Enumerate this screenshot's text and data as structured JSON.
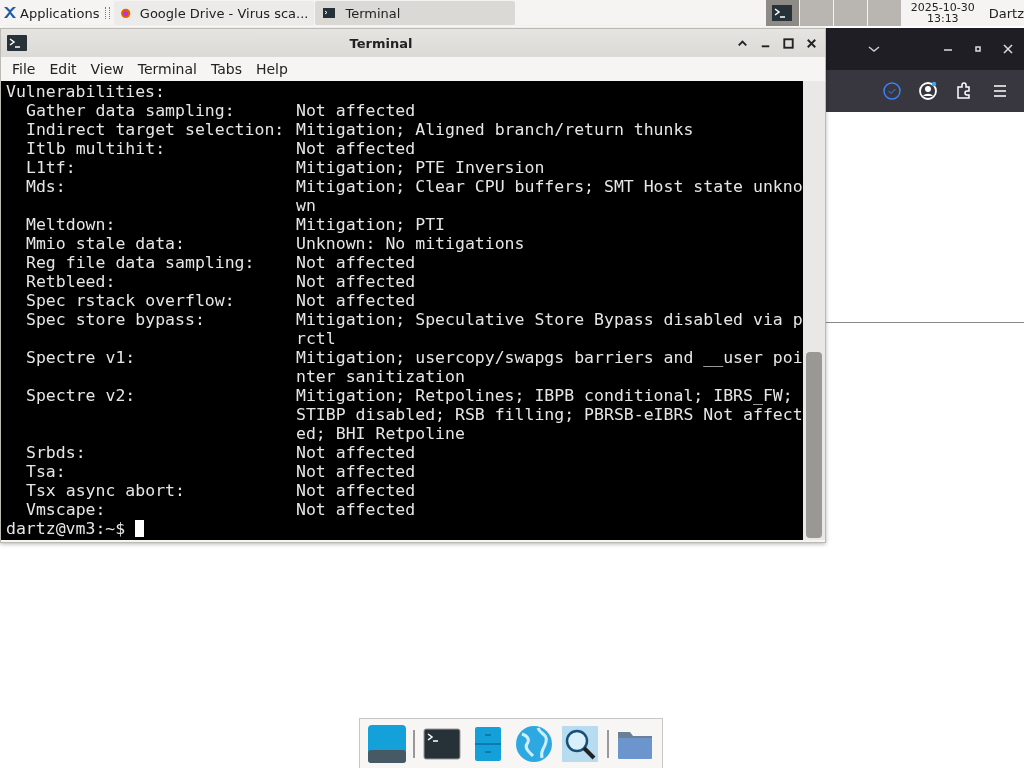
{
  "panel": {
    "apps_label": "Applications",
    "tasks": [
      {
        "title": "Google Drive - Virus sca...",
        "kind": "browser",
        "selected": false
      },
      {
        "title": "Terminal",
        "kind": "terminal",
        "selected": true
      }
    ],
    "workspaces": [
      {
        "selected": true
      },
      {
        "selected": false
      },
      {
        "selected": false
      },
      {
        "selected": false
      }
    ],
    "date": "2025-10-30",
    "time": "13:13",
    "user": "Dartz"
  },
  "terminal": {
    "title": "Terminal",
    "menu": [
      "File",
      "Edit",
      "View",
      "Terminal",
      "Tabs",
      "Help"
    ],
    "heading": "Vulnerabilities:",
    "rows": [
      {
        "label": "Gather data sampling:",
        "value_lines": [
          "Not affected"
        ]
      },
      {
        "label": "Indirect target selection:",
        "value_lines": [
          "Mitigation; Aligned branch/return thunks"
        ]
      },
      {
        "label": "Itlb multihit:",
        "value_lines": [
          "Not affected"
        ]
      },
      {
        "label": "L1tf:",
        "value_lines": [
          "Mitigation; PTE Inversion"
        ]
      },
      {
        "label": "Mds:",
        "value_lines": [
          "Mitigation; Clear CPU buffers; SMT Host state unkno",
          "wn"
        ]
      },
      {
        "label": "Meltdown:",
        "value_lines": [
          "Mitigation; PTI"
        ]
      },
      {
        "label": "Mmio stale data:",
        "value_lines": [
          "Unknown: No mitigations"
        ]
      },
      {
        "label": "Reg file data sampling:",
        "value_lines": [
          "Not affected"
        ]
      },
      {
        "label": "Retbleed:",
        "value_lines": [
          "Not affected"
        ]
      },
      {
        "label": "Spec rstack overflow:",
        "value_lines": [
          "Not affected"
        ]
      },
      {
        "label": "Spec store bypass:",
        "value_lines": [
          "Mitigation; Speculative Store Bypass disabled via p",
          "rctl"
        ]
      },
      {
        "label": "Spectre v1:",
        "value_lines": [
          "Mitigation; usercopy/swapgs barriers and __user poi",
          "nter sanitization"
        ]
      },
      {
        "label": "Spectre v2:",
        "value_lines": [
          "Mitigation; Retpolines; IBPB conditional; IBRS_FW;",
          "STIBP disabled; RSB filling; PBRSB-eIBRS Not affect",
          "ed; BHI Retpoline"
        ]
      },
      {
        "label": "Srbds:",
        "value_lines": [
          "Not affected"
        ]
      },
      {
        "label": "Tsa:",
        "value_lines": [
          "Not affected"
        ]
      },
      {
        "label": "Tsx async abort:",
        "value_lines": [
          "Not affected"
        ]
      },
      {
        "label": "Vmscape:",
        "value_lines": [
          "Not affected"
        ]
      }
    ],
    "prompt": "dartz@vm3:~$"
  }
}
